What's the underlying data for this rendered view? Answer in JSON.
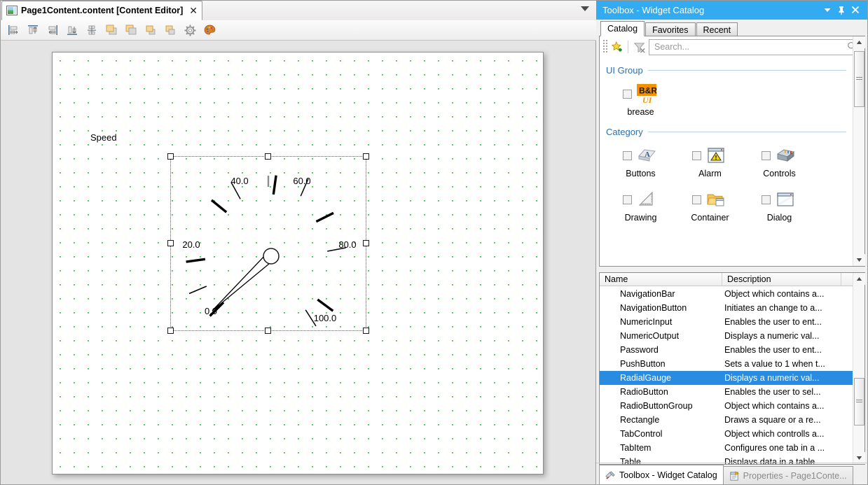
{
  "editor": {
    "tab": {
      "title": "Page1Content.content [Content Editor]",
      "close_label": "✕",
      "icon": "content-editor-icon"
    },
    "tablist_dropdown": "tab-list-dropdown-icon",
    "toolbar": [
      {
        "name": "align-left-button",
        "icon": "align-left-icon"
      },
      {
        "name": "align-top-button",
        "icon": "align-top-icon"
      },
      {
        "name": "align-right-button",
        "icon": "align-right-icon"
      },
      {
        "name": "align-bottom-button",
        "icon": "align-bottom-icon"
      },
      {
        "name": "distribute-vertical-button",
        "icon": "distribute-vertical-icon"
      },
      {
        "name": "bring-to-front-button",
        "icon": "bring-to-front-icon"
      },
      {
        "name": "send-to-back-button",
        "icon": "send-to-back-icon"
      },
      {
        "name": "bring-forward-button",
        "icon": "bring-forward-icon"
      },
      {
        "name": "send-backward-button",
        "icon": "send-backward-icon"
      },
      {
        "name": "settings-button",
        "icon": "gear-icon"
      },
      {
        "name": "theme-palette-button",
        "icon": "palette-icon"
      }
    ],
    "canvas": {
      "label_speed": "Speed",
      "grid_color": "#18d818",
      "background": "#ffffff"
    }
  },
  "gauge": {
    "type": "RadialGauge",
    "selected": true,
    "value": 0.0,
    "min": 0.0,
    "max": 100.0,
    "tick_labels": [
      "0.0",
      "20.0",
      "40.0",
      "60.0",
      "80.0",
      "100.0"
    ],
    "major_ticks": [
      0,
      20,
      40,
      60,
      80,
      100
    ],
    "minor_ticks": [
      10,
      30,
      50,
      70,
      90
    ],
    "start_angle_deg": 225,
    "sweep_deg": 270,
    "needle_color": "#000000"
  },
  "toolbox": {
    "title": "Toolbox - Widget Catalog",
    "title_buttons": [
      {
        "name": "panel-menu-button",
        "icon": "chevron-down-icon",
        "glyph": "▼"
      },
      {
        "name": "panel-pin-button",
        "icon": "pin-icon",
        "glyph": "⥡"
      },
      {
        "name": "panel-close-button",
        "icon": "close-icon",
        "glyph": "✕"
      }
    ],
    "tabs": [
      {
        "label": "Catalog",
        "active": true
      },
      {
        "label": "Favorites",
        "active": false
      },
      {
        "label": "Recent",
        "active": false
      }
    ],
    "toolstrip": [
      {
        "name": "add-to-favorites-button",
        "icon": "star-add-icon"
      },
      {
        "name": "clear-filter-button",
        "icon": "filter-clear-icon"
      }
    ],
    "search": {
      "placeholder": "Search...",
      "value": "",
      "icon": "search-icon"
    },
    "ui_group": {
      "header": "UI Group",
      "items": [
        {
          "label": "brease",
          "icon": "br-ui-logo-icon",
          "checked": false
        }
      ]
    },
    "category": {
      "header": "Category",
      "items": [
        {
          "label": "Buttons",
          "icon": "buttons-icon",
          "checked": false
        },
        {
          "label": "Alarm",
          "icon": "alarm-icon",
          "checked": false
        },
        {
          "label": "Controls",
          "icon": "controls-icon",
          "checked": false
        },
        {
          "label": "Drawing",
          "icon": "drawing-icon",
          "checked": false
        },
        {
          "label": "Container",
          "icon": "container-icon",
          "checked": false
        },
        {
          "label": "Dialog",
          "icon": "dialog-icon",
          "checked": false
        }
      ]
    },
    "list": {
      "columns": [
        "Name",
        "Description"
      ],
      "rows": [
        {
          "name": "NavigationBar",
          "description": "Object which contains a...",
          "selected": false
        },
        {
          "name": "NavigationButton",
          "description": "Initiates an change to a...",
          "selected": false
        },
        {
          "name": "NumericInput",
          "description": "Enables the user to ent...",
          "selected": false
        },
        {
          "name": "NumericOutput",
          "description": "Displays a numeric val...",
          "selected": false
        },
        {
          "name": "Password",
          "description": "Enables the user to ent...",
          "selected": false
        },
        {
          "name": "PushButton",
          "description": "Sets a value to 1 when t...",
          "selected": false
        },
        {
          "name": "RadialGauge",
          "description": "Displays a numeric val...",
          "selected": true
        },
        {
          "name": "RadioButton",
          "description": "Enables the user to sel...",
          "selected": false
        },
        {
          "name": "RadioButtonGroup",
          "description": "Object which contains a...",
          "selected": false
        },
        {
          "name": "Rectangle",
          "description": "Draws a square or a re...",
          "selected": false
        },
        {
          "name": "TabControl",
          "description": "Object which controlls a...",
          "selected": false
        },
        {
          "name": "TabItem",
          "description": "Configures one tab in a ...",
          "selected": false
        },
        {
          "name": "Table",
          "description": "Displays data in a table",
          "selected": false
        }
      ]
    },
    "bottom_tabs": [
      {
        "label": "Toolbox - Widget Catalog",
        "icon": "toolbox-icon",
        "active": true
      },
      {
        "label": "Properties - Page1Conte...",
        "icon": "properties-icon",
        "active": false
      }
    ],
    "accent_color": "#32abf0",
    "selection_color": "#2a8ce0"
  }
}
